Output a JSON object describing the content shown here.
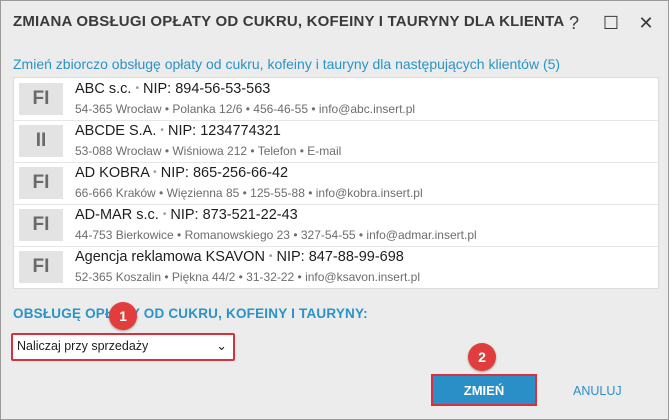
{
  "dialog": {
    "title": "ZMIANA OBSŁUGI OPŁATY OD CUKRU, KOFEINY I TAURYNY DLA KLIENTA",
    "help_icon": "?",
    "maximize_icon": "☐",
    "close_icon": "✕"
  },
  "subtitle": "Zmień zbiorczo obsługę opłaty od cukru, kofeiny i tauryny dla następujących klientów (5)",
  "clients": [
    {
      "badge": "FI",
      "name": "ABC s.c.",
      "nip": "NIP: 894-56-53-563",
      "address": "54-365 Wrocław • Polanka  12/6  • 456-46-55 • info@abc.insert.pl"
    },
    {
      "badge": "II",
      "name": "ABCDE S.A.",
      "nip": "NIP: 1234774321",
      "address": "53-088 Wrocław • Wiśniowa 212 • Telefon • E-mail"
    },
    {
      "badge": "FI",
      "name": "AD KOBRA",
      "nip": "NIP: 865-256-66-42",
      "address": "66-666 Kraków • Więzienna  85  • 125-55-88 • info@kobra.insert.pl"
    },
    {
      "badge": "FI",
      "name": "AD-MAR s.c.",
      "nip": "NIP: 873-521-22-43",
      "address": "44-753 Bierkowice • Romanowskiego 23  • 327-54-55 • info@admar.insert.pl"
    },
    {
      "badge": "FI",
      "name": "Agencja reklamowa KSAVON",
      "nip": "NIP: 847-88-99-698",
      "address": "52-365 Koszalin • Piękna  44/2  • 31-32-22 • info@ksavon.insert.pl"
    }
  ],
  "section_label": "OBSŁUGĘ OPŁATY OD CUKRU, KOFEINY I TAURYNY:",
  "select": {
    "value": "Naliczaj przy sprzedaży",
    "chevron": "⌄"
  },
  "markers": {
    "m1": "1",
    "m2": "2"
  },
  "buttons": {
    "confirm": "ZMIEŃ",
    "cancel": "ANULUJ"
  },
  "colors": {
    "accent": "#2a8fc6",
    "highlight": "#d9303e",
    "marker": "#e23d3d"
  }
}
